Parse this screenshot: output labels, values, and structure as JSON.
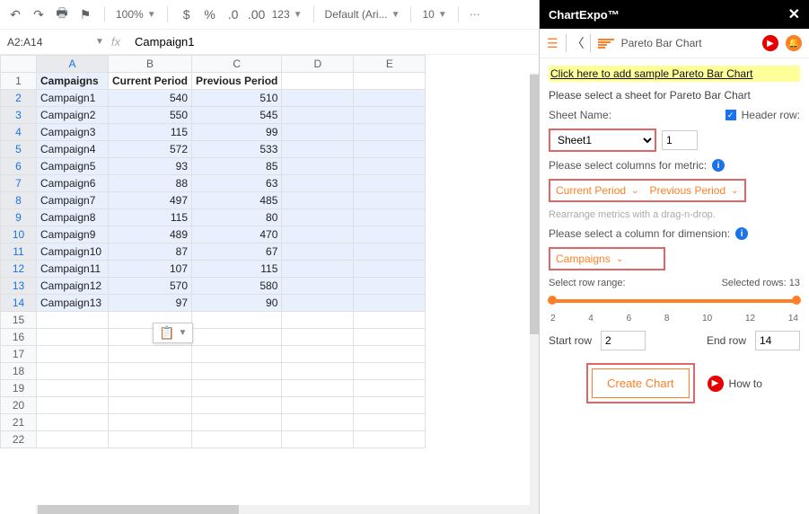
{
  "toolbar": {
    "zoom": "100%",
    "currency": "$",
    "percent": "%",
    "dec_dec": ".0",
    "inc_dec": ".00",
    "number_format": "123",
    "font": "Default (Ari...",
    "font_size": "10"
  },
  "name_box": "A2:A14",
  "fx_label": "fx",
  "formula_value": "Campaign1",
  "columns": [
    "A",
    "B",
    "C",
    "D",
    "E"
  ],
  "header_row": [
    "Campaigns",
    "Current Period",
    "Previous Period"
  ],
  "data_rows": [
    [
      "Campaign1",
      "540",
      "510"
    ],
    [
      "Campaign2",
      "550",
      "545"
    ],
    [
      "Campaign3",
      "115",
      "99"
    ],
    [
      "Campaign4",
      "572",
      "533"
    ],
    [
      "Campaign5",
      "93",
      "85"
    ],
    [
      "Campaign6",
      "88",
      "63"
    ],
    [
      "Campaign7",
      "497",
      "485"
    ],
    [
      "Campaign8",
      "115",
      "80"
    ],
    [
      "Campaign9",
      "489",
      "470"
    ],
    [
      "Campaign10",
      "87",
      "67"
    ],
    [
      "Campaign11",
      "107",
      "115"
    ],
    [
      "Campaign12",
      "570",
      "580"
    ],
    [
      "Campaign13",
      "97",
      "90"
    ]
  ],
  "empty_rows": [
    15,
    16,
    17,
    18,
    19,
    20,
    21,
    22
  ],
  "panel": {
    "title": "ChartExpo™",
    "chart_type": "Pareto Bar Chart",
    "sample_link": "Click here to add sample Pareto Bar Chart",
    "select_sheet_label": "Please select a sheet for Pareto Bar Chart",
    "sheet_name_label": "Sheet Name:",
    "header_row_label": "Header row:",
    "sheet_value": "Sheet1",
    "header_row_value": "1",
    "metric_label": "Please select columns for metric:",
    "metric1": "Current Period",
    "metric2": "Previous Period",
    "metric_hint": "Rearrange metrics with a drag-n-drop.",
    "dimension_label": "Please select a column for dimension:",
    "dimension_value": "Campaigns",
    "range_label": "Select row range:",
    "selected_rows_label": "Selected rows: 13",
    "ticks": [
      "2",
      "4",
      "6",
      "8",
      "10",
      "12",
      "14"
    ],
    "start_row_label": "Start row",
    "start_row_value": "2",
    "end_row_label": "End row",
    "end_row_value": "14",
    "create_label": "Create Chart",
    "howto_label": "How to"
  }
}
